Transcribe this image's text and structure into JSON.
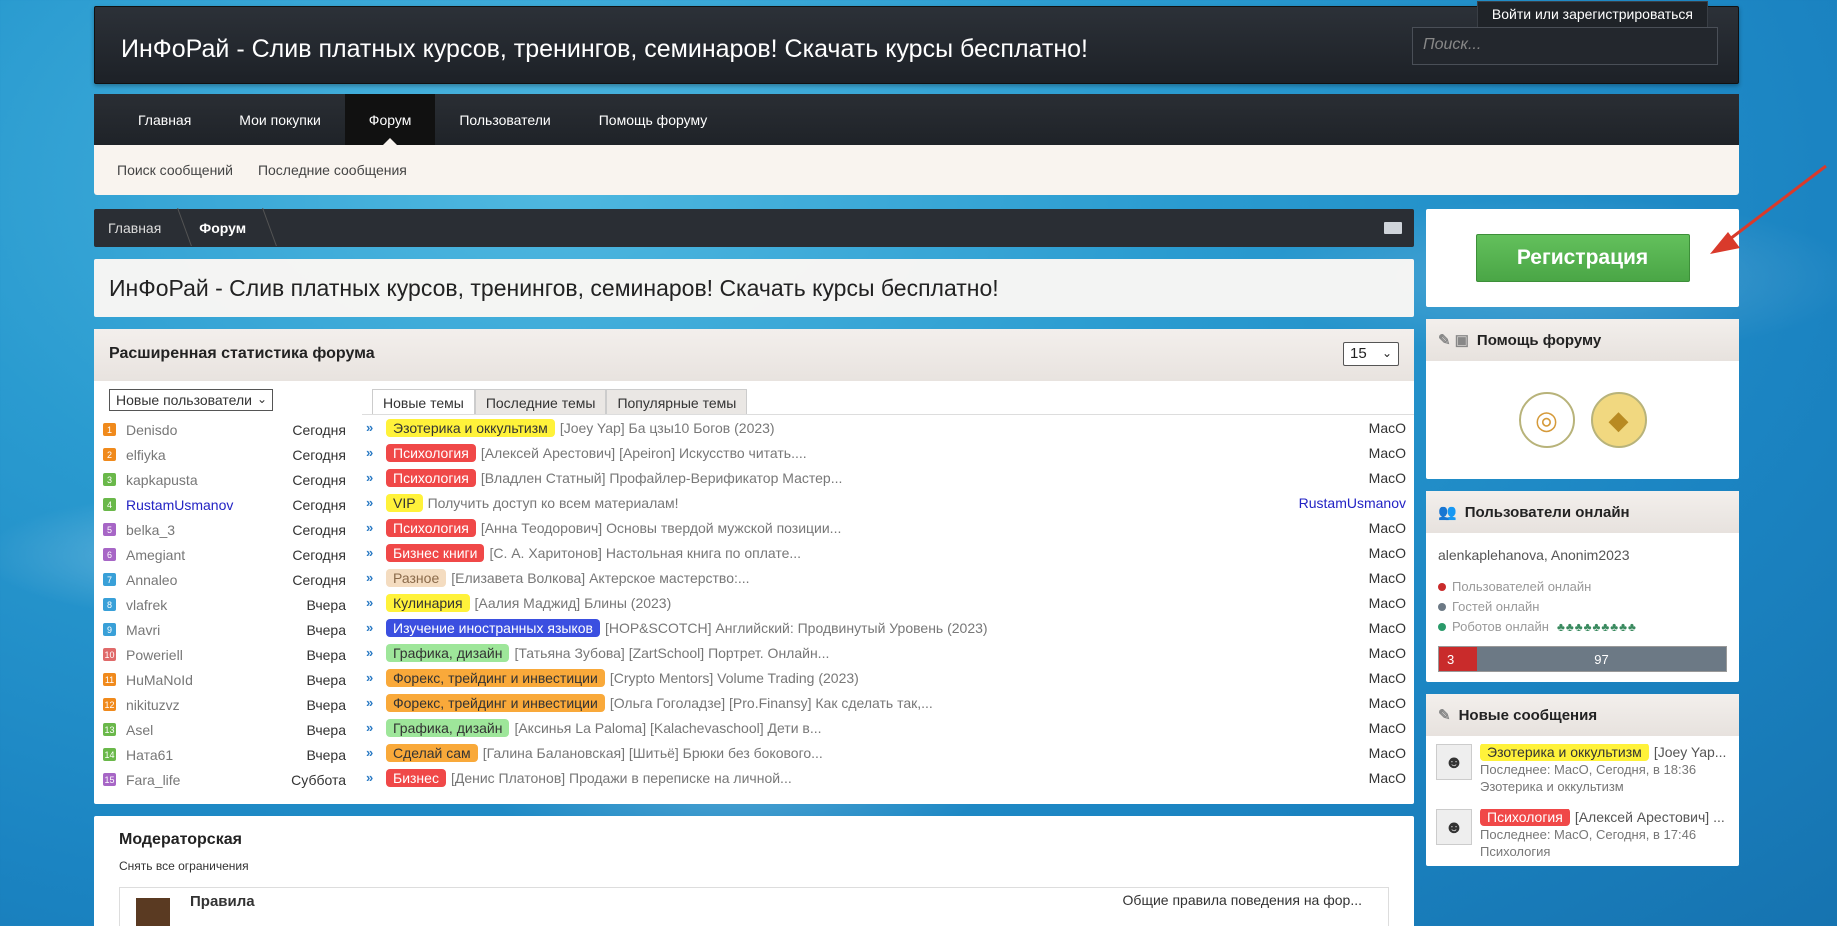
{
  "header": {
    "site_title": "ИнФоРай - Слив платных курсов, тренингов, семинаров! Скачать курсы бесплатно!",
    "login_link": "Войти или зарегистрироваться",
    "search_placeholder": "Поиск..."
  },
  "nav": {
    "tabs": [
      "Главная",
      "Мои покупки",
      "Форум",
      "Пользователи",
      "Помощь форуму"
    ],
    "active": "Форум",
    "sub": [
      "Поиск сообщений",
      "Последние сообщения"
    ]
  },
  "breadcrumb": [
    "Главная",
    "Форум"
  ],
  "page_title": "ИнФоРай - Слив платных курсов, тренингов, семинаров! Скачать курсы бесплатно!",
  "stats": {
    "title": "Расширенная статистика форума",
    "count_select": "15",
    "user_filter": "Новые пользователи",
    "users": [
      {
        "n": "1",
        "name": "Denisdo",
        "when": "Сегодня",
        "color": "#f08a1c"
      },
      {
        "n": "2",
        "name": "elfiyka",
        "when": "Сегодня",
        "color": "#f08a1c"
      },
      {
        "n": "3",
        "name": "kapkapusta",
        "when": "Сегодня",
        "color": "#6ab84a"
      },
      {
        "n": "4",
        "name": "RustamUsmanov",
        "when": "Сегодня",
        "color": "#6ab84a",
        "blue": true
      },
      {
        "n": "5",
        "name": "belka_3",
        "when": "Сегодня",
        "color": "#a766c6"
      },
      {
        "n": "6",
        "name": "Amegiant",
        "when": "Сегодня",
        "color": "#a766c6"
      },
      {
        "n": "7",
        "name": "Annaleo",
        "when": "Сегодня",
        "color": "#39a0d8"
      },
      {
        "n": "8",
        "name": "vlafrek",
        "when": "Вчера",
        "color": "#39a0d8"
      },
      {
        "n": "9",
        "name": "Mavri",
        "when": "Вчера",
        "color": "#39a0d8"
      },
      {
        "n": "10",
        "name": "Poweriell",
        "when": "Вчера",
        "color": "#e06a6a"
      },
      {
        "n": "11",
        "name": "HuMaNoId",
        "when": "Вчера",
        "color": "#f08a1c"
      },
      {
        "n": "12",
        "name": "nikituzvz",
        "when": "Вчера",
        "color": "#f08a1c"
      },
      {
        "n": "13",
        "name": "Asel",
        "when": "Вчера",
        "color": "#6ab84a"
      },
      {
        "n": "14",
        "name": "Ната61",
        "when": "Вчера",
        "color": "#6ab84a"
      },
      {
        "n": "15",
        "name": "Fara_life",
        "when": "Суббота",
        "color": "#a766c6"
      }
    ],
    "tabs": [
      "Новые темы",
      "Последние темы",
      "Популярные темы"
    ],
    "topics": [
      {
        "tag": "Эзотерика и оккультизм",
        "bg": "#fff23a",
        "fg": "#333",
        "title": "[Joey Yap] Ба цзы10 Богов (2023)",
        "author": "MacO"
      },
      {
        "tag": "Психология",
        "bg": "#f04848",
        "fg": "#fff",
        "title": "[Алексей Арестович] [Apeiron] Искусство читать....",
        "author": "MacO"
      },
      {
        "tag": "Психология",
        "bg": "#f04848",
        "fg": "#fff",
        "title": "[Владлен Статный] Профайлер-Верификатор Мастер...",
        "author": "MacO"
      },
      {
        "tag": "VIP",
        "bg": "#fff23a",
        "fg": "#333",
        "title": "Получить доступ ко всем материалам!",
        "author": "RustamUsmanov",
        "blue": true
      },
      {
        "tag": "Психология",
        "bg": "#f04848",
        "fg": "#fff",
        "title": "[Анна Теодорович] Основы твердой мужской позиции...",
        "author": "MacO"
      },
      {
        "tag": "Бизнес книги",
        "bg": "#f04848",
        "fg": "#fff",
        "title": "[С. А. Харитонов] Настольная книга по оплате...",
        "author": "MacO"
      },
      {
        "tag": "Разное",
        "bg": "#f4dcc0",
        "fg": "#8a6a4a",
        "title": "[Елизавета Волкова] Актерское мастерство:...",
        "author": "MacO"
      },
      {
        "tag": "Кулинария",
        "bg": "#fff23a",
        "fg": "#333",
        "title": "[Аалия Маджид] Блины (2023)",
        "author": "MacO"
      },
      {
        "tag": "Изучение иностранных языков",
        "bg": "#3b4fe0",
        "fg": "#fff",
        "title": "[HOP&SCOTCH] Английский: Продвинутый Уровень (2023)",
        "author": "MacO"
      },
      {
        "tag": "Графика, дизайн",
        "bg": "#9ee69a",
        "fg": "#333",
        "title": "[Татьяна Зубова] [ZartSchool] Портрет. Онлайн...",
        "author": "MacO"
      },
      {
        "tag": "Форекс, трейдинг и инвестиции",
        "bg": "#f9a93a",
        "fg": "#333",
        "title": "[Crypto Mentors] Volume Trading (2023)",
        "author": "MacO"
      },
      {
        "tag": "Форекс, трейдинг и инвестиции",
        "bg": "#f9a93a",
        "fg": "#333",
        "title": "[Ольга Гоголадзе] [Pro.Finansy] Как сделать так,...",
        "author": "MacO"
      },
      {
        "tag": "Графика, дизайн",
        "bg": "#9ee69a",
        "fg": "#333",
        "title": "[Аксинья La Paloma] [Kalachevaschool] Дети в...",
        "author": "MacO"
      },
      {
        "tag": "Сделай сам",
        "bg": "#f9a93a",
        "fg": "#333",
        "title": "[Галина Балановская] [Шитьё] Брюки без бокового...",
        "author": "MacO"
      },
      {
        "tag": "Бизнес",
        "bg": "#f04848",
        "fg": "#fff",
        "title": "[Денис Платонов] Продажи в переписке на личной...",
        "author": "MacO"
      }
    ]
  },
  "moderator": {
    "title": "Модераторская",
    "sub": "Снять все ограничения",
    "rules": "Правила",
    "rules_right": "Общие правила поведения на фор..."
  },
  "sidebar": {
    "register": "Регистрация",
    "help_title": "Помощь форуму",
    "online_title": "Пользователи онлайн",
    "online_names": "alenkaplehanova, Anonim2023",
    "users_online": "Пользователей онлайн",
    "guests_online": "Гостей онлайн",
    "robots_online": "Роботов онлайн",
    "bar_users": "3",
    "bar_guests": "97",
    "news_title": "Новые сообщения",
    "news": [
      {
        "tag": "Эзотерика и оккультизм",
        "bg": "#fff23a",
        "fg": "#333",
        "title": "[Joey Yap...",
        "meta": "Последнее: MacO, Сегодня, в 18:36",
        "forum": "Эзотерика и оккультизм"
      },
      {
        "tag": "Психология",
        "bg": "#f04848",
        "fg": "#fff",
        "title": "[Алексей Арестович] ...",
        "meta": "Последнее: MacO, Сегодня, в 17:46",
        "forum": "Психология"
      }
    ]
  }
}
